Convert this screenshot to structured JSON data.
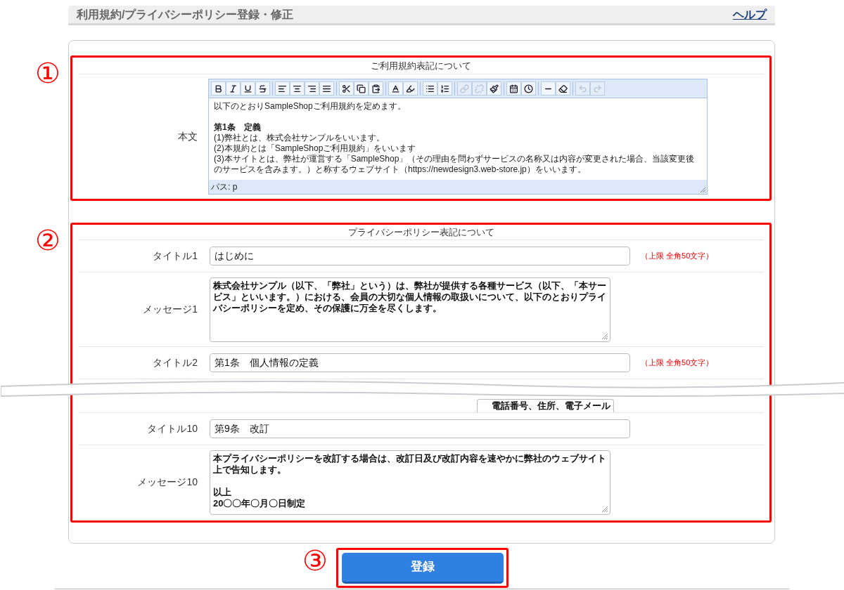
{
  "header": {
    "title": "利用規約/プライバシーポリシー登録・修正",
    "help_link": "ヘルプ"
  },
  "terms_section": {
    "marker": "①",
    "heading": "ご利用規約表記について",
    "label": "本文",
    "toolbar": [
      {
        "disabled": false
      },
      {
        "disabled": false
      },
      {
        "disabled": false
      },
      {
        "disabled": false
      },
      {
        "disabled": false
      },
      {
        "disabled": false
      },
      {
        "disabled": false
      },
      {
        "disabled": false
      },
      {
        "disabled": false
      },
      {
        "disabled": false
      },
      {
        "disabled": false
      },
      {
        "disabled": false
      },
      {
        "disabled": false
      },
      {
        "disabled": false
      },
      {
        "disabled": false
      },
      {
        "disabled": true
      },
      {
        "disabled": true
      },
      {
        "disabled": false
      },
      {
        "disabled": false
      },
      {
        "disabled": false
      },
      {
        "disabled": false
      },
      {
        "disabled": false
      },
      {
        "disabled": true
      },
      {
        "disabled": true
      }
    ],
    "lines": [
      {
        "kind": "text",
        "text": "以下のとおりSampleShopご利用規約を定めます。"
      },
      {
        "kind": "blank"
      },
      {
        "kind": "heading",
        "text": "第1条　定義"
      },
      {
        "kind": "text",
        "text": "(1)弊社とは、株式会社サンプルをいいます。"
      },
      {
        "kind": "text",
        "text": "(2)本規約とは「SampleShopご利用規約」をいいます"
      },
      {
        "kind": "text",
        "text": "(3)本サイトとは、弊社が運営する「SampleShop」（その理由を問わずサービスの名称又は内容が変更された場合、当該変更後のサービスを含みます。）と称するウェブサイト（https://newdesign3.web-store.jp）をいいます。"
      }
    ],
    "path": "パス: p"
  },
  "privacy_section": {
    "marker": "②",
    "heading": "プライバシーポリシー表記について",
    "rows": [
      {
        "kind": "title",
        "label": "タイトル1",
        "value": "はじめに",
        "hint": "（上限 全角50文字）"
      },
      {
        "kind": "message",
        "label": "メッセージ1",
        "paragraphs": [
          [
            "株式会社サンプル（以下、「弊社」という）は、弊社が提供する各種サービス（以下、「本サービス」といいます。）における、会員の大切な個人情報の取扱いについて、以下のとおりプライバシーポリシーを定め、その保護に万全を尽くします。"
          ]
        ]
      },
      {
        "kind": "title",
        "label": "タイトル2",
        "value": "第1条　個人情報の定義",
        "hint": "（上限 全角50文字）"
      },
      {
        "kind": "fragment",
        "value": "電話番号、住所、電子メール"
      },
      {
        "kind": "title",
        "label": "タイトル10",
        "value": "第9条　改訂"
      },
      {
        "kind": "message",
        "label": "メッセージ10",
        "paragraphs": [
          [
            "本プライバシーポリシーを改訂する場合は、改訂日及び改訂内容を速やかに弊社のウェブサイト上で告知します。"
          ],
          [
            "以上",
            "20〇〇年〇月〇日制定"
          ]
        ]
      }
    ]
  },
  "submit": {
    "marker": "③",
    "label": "登録"
  }
}
